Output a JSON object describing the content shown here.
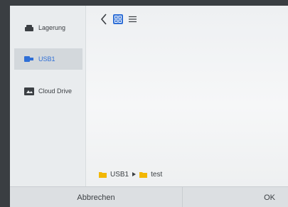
{
  "sidebar": {
    "items": [
      {
        "label": "Lagerung",
        "icon": "storage-icon",
        "selected": false
      },
      {
        "label": "USB1",
        "icon": "usb-icon",
        "selected": true
      },
      {
        "label": "Cloud Drive",
        "icon": "cloud-drive-icon",
        "selected": false
      }
    ]
  },
  "toolbar": {
    "back_icon": "chevron-left-icon",
    "grid_view_icon": "grid-view-icon",
    "list_view_icon": "list-view-icon",
    "active_view": "grid"
  },
  "path": {
    "segments": [
      "USB1",
      "test"
    ],
    "separator_icon": "triangle-right-icon"
  },
  "footer": {
    "cancel_label": "Abbrechen",
    "ok_label": "OK"
  },
  "colors": {
    "accent": "#2f6fd6",
    "folder": "#f2b705"
  }
}
